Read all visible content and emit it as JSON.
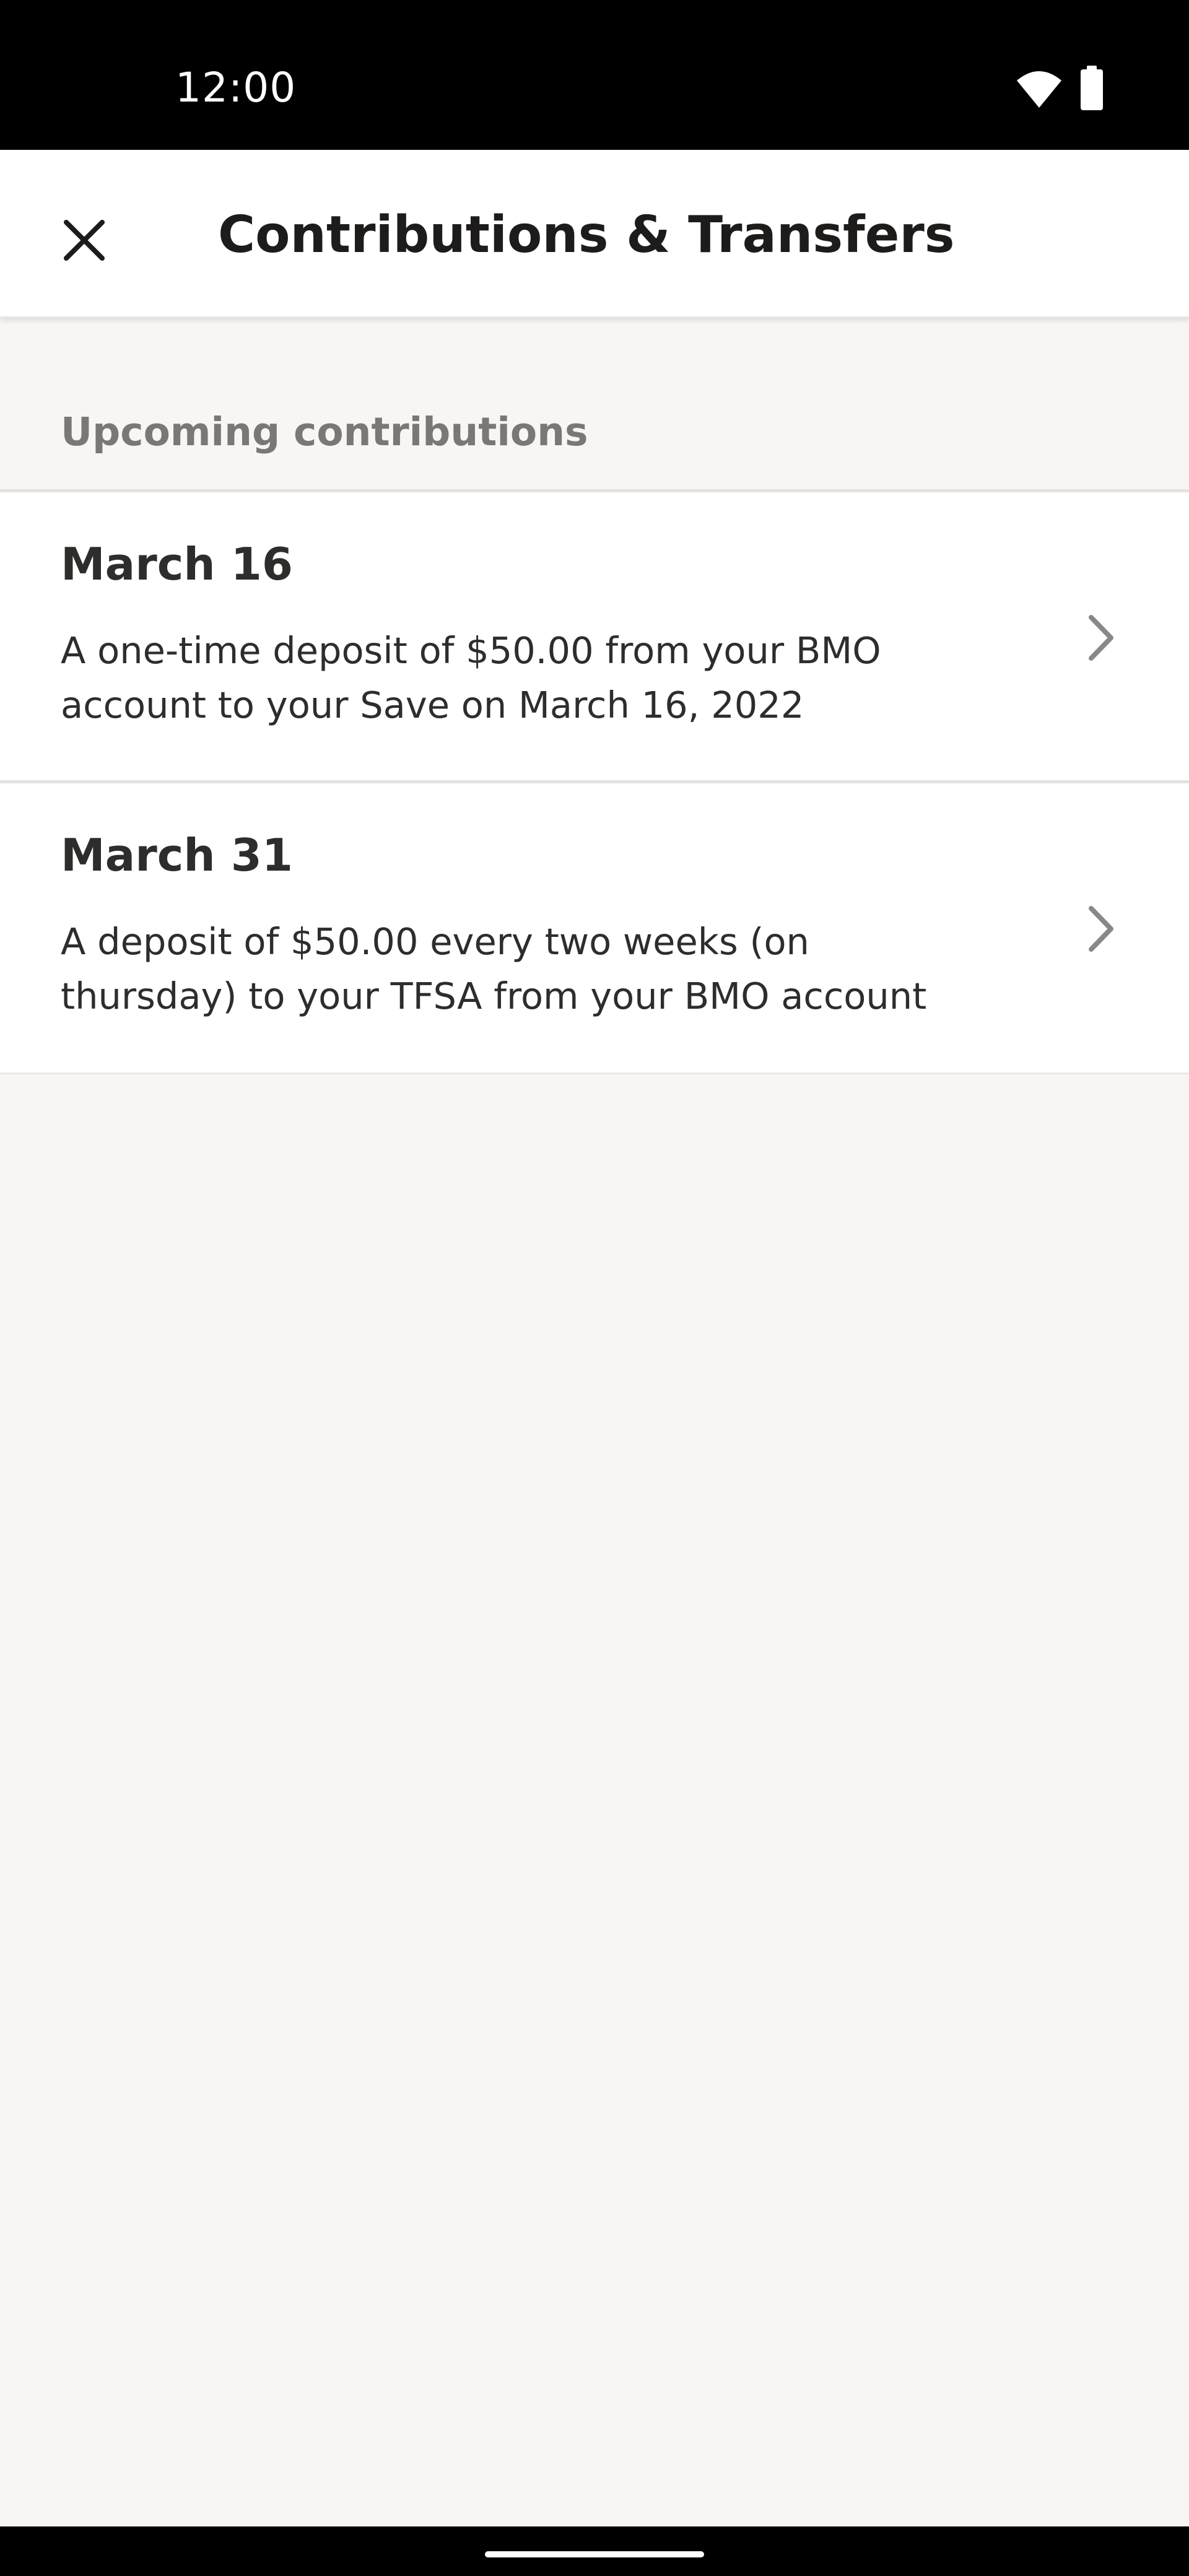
{
  "status_bar": {
    "time": "12:00",
    "icons": [
      "wifi-icon",
      "battery-icon"
    ]
  },
  "header": {
    "close_icon": "close-icon",
    "title": "Contributions & Transfers"
  },
  "section": {
    "title": "Upcoming contributions"
  },
  "contributions": [
    {
      "date": "March 16",
      "description": "A one-time deposit of $50.00 from your BMO account to your Save on March 16, 2022"
    },
    {
      "date": "March 31",
      "description": "A deposit of $50.00 every two weeks (on thursday) to your TFSA from your BMO account"
    }
  ],
  "colors": {
    "background": "#f7f6f4",
    "surface": "#ffffff",
    "text_primary": "#1d1c1b",
    "text_secondary": "#7a7876",
    "chevron": "#8a8886",
    "divider": "#e3e2df"
  }
}
